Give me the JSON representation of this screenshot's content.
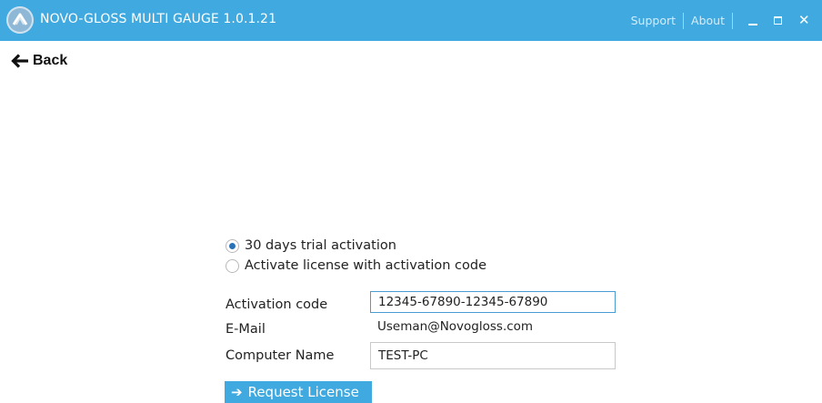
{
  "window": {
    "title": "NOVO-GLOSS MULTI GAUGE 1.0.1.21",
    "links": {
      "support": "Support",
      "about": "About"
    },
    "controls": {
      "minimize_icon": "minimize-icon",
      "maximize_icon": "maximize-icon",
      "close_icon": "close-icon",
      "close_glyph": "✕"
    },
    "logo_icon": "app-logo-icon"
  },
  "nav": {
    "back_label": "Back",
    "back_icon": "arrow-left-icon"
  },
  "activation": {
    "options": [
      {
        "label": "30 days trial activation",
        "selected": true
      },
      {
        "label": "Activate license with activation code",
        "selected": false
      }
    ],
    "fields": {
      "activation_code": {
        "label": "Activation code",
        "value": "12345-67890-12345-67890"
      },
      "email": {
        "label": "E-Mail",
        "value": "Useman@Novogloss.com"
      },
      "computer_name": {
        "label": "Computer Name",
        "value": "TEST-PC"
      }
    },
    "request_button": {
      "label": "Request License",
      "icon": "arrow-right-icon",
      "glyph": "➔"
    }
  },
  "colors": {
    "accent": "#3fa9e0",
    "radio_checked": "#2a72b8",
    "input_focus_border": "#4b9cd3"
  }
}
